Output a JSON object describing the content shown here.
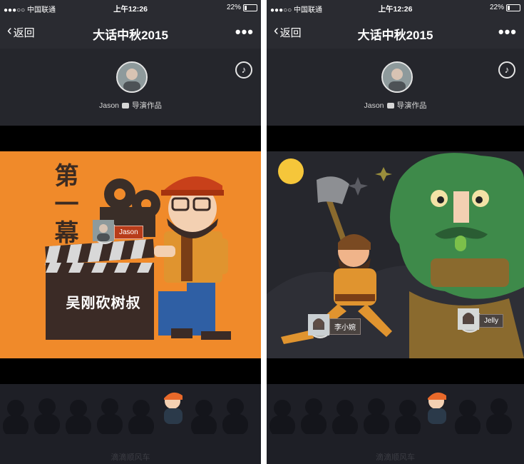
{
  "status": {
    "carrier": "●●●○○ 中国联通",
    "time": "上午12:26",
    "battery": "22%"
  },
  "nav": {
    "back_label": "返回",
    "title": "大话中秋2015",
    "more_label": "•••"
  },
  "header": {
    "author_name": "Jason",
    "author_suffix": "导演作品"
  },
  "scene1": {
    "title_text": "第一幕",
    "character_name": "吴刚砍树叔",
    "tag_name": "Jason"
  },
  "scene2": {
    "tag_left": "李小婉",
    "tag_right": "Jelly"
  },
  "footer": {
    "text": "滴滴顺风车"
  },
  "colors": {
    "scene1_bg": "#f08a2a",
    "scene2_bg": "#26272d",
    "tree_green": "#3e8a4a"
  }
}
